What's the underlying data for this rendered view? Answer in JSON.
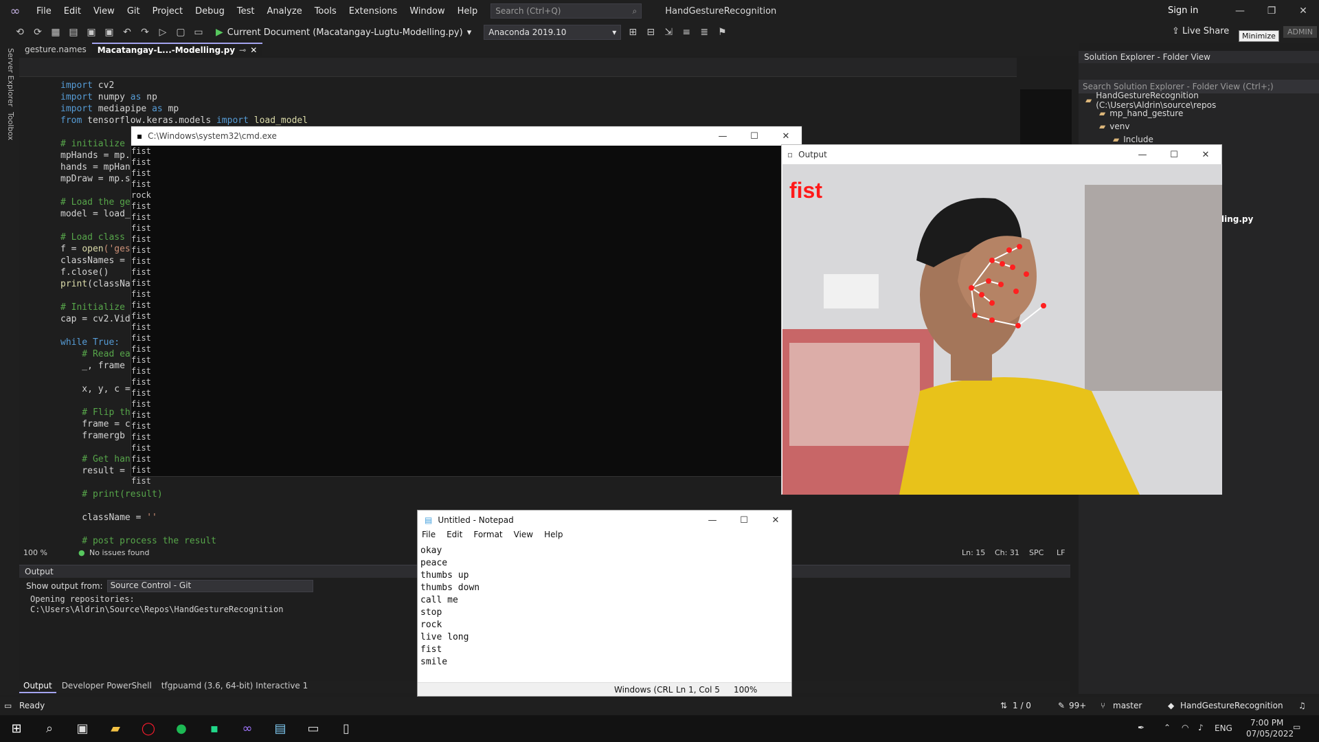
{
  "app": {
    "menus": [
      "File",
      "Edit",
      "View",
      "Git",
      "Project",
      "Debug",
      "Test",
      "Analyze",
      "Tools",
      "Extensions",
      "Window",
      "Help"
    ],
    "search_placeholder": "Search (Ctrl+Q)",
    "solution_name": "HandGestureRecognition",
    "sign_in": "Sign in",
    "live_share": "Live Share",
    "admin": "ADMIN",
    "tooltip": "Minimize"
  },
  "toolbar": {
    "run_label": "Current Document (Macatangay-Lugtu-Modelling.py)",
    "environment": "Anaconda 2019.10"
  },
  "side": {
    "server_explorer": "Server Explorer",
    "toolbox": "Toolbox"
  },
  "tabs": [
    {
      "label": "gesture.names"
    },
    {
      "label": "Macatangay-L...-Modelling.py"
    }
  ],
  "code": {
    "l1_kw": "import",
    "l1_rest": " cv2",
    "l2_kw": "import",
    "l2_rest": " numpy ",
    "l2_as": "as",
    "l2_alias": " np",
    "l3_kw": "import",
    "l3_rest": " mediapipe ",
    "l3_as": "as",
    "l3_alias": " mp",
    "l4_kw": "from",
    "l4_rest": " tensorflow.keras.models ",
    "l4_imp": "import",
    "l4_fn": " load_model",
    "l6": "# initialize m",
    "l7": "mpHands = mp.s",
    "l8": "hands = mpHand",
    "l9": "mpDraw = mp.so",
    "l11": "# Load the ges",
    "l12": "model = load_m",
    "l14": "# Load class n",
    "l15a": "f = ",
    "l15b": "open",
    "l15c": "('ges",
    "l16": "classNames = f",
    "l17": "f.close()",
    "l18a": "print",
    "l18b": "(classNam",
    "l20": "# Initialize t",
    "l21": "cap = cv2.Vide",
    "l23a": "while",
    "l23b": " True:",
    "l24": "    # Read eac",
    "l25": "    _, frame =",
    "l27": "    x, y, c =",
    "l29": "    # Flip the",
    "l30": "    frame = cv",
    "l31": "    framergb =",
    "l33": "    # Get hand",
    "l34": "    result = h",
    "l36": "    # print(result)",
    "l38a": "    className = ",
    "l38b": "''",
    "l40": "    # post process the result"
  },
  "editor_status": {
    "zoom": "100 %",
    "issues": "No issues found",
    "ln": "Ln: 15",
    "ch": "Ch: 31",
    "spc": "SPC",
    "lf": "LF"
  },
  "output_panel": {
    "title": "Output",
    "show_from_label": "Show output from:",
    "source": "Source Control - Git",
    "lines": [
      "Opening repositories:",
      "C:\\Users\\Aldrin\\Source\\Repos\\HandGestureRecognition"
    ]
  },
  "bottom_tabs": [
    "Output",
    "Developer PowerShell",
    "tfgpuamd (3.6, 64-bit) Interactive 1"
  ],
  "status_bar": {
    "ready": "Ready",
    "sync": "1 / 0",
    "changes": "99+",
    "branch": "master",
    "repo": "HandGestureRecognition"
  },
  "solution_explorer": {
    "title": "Solution Explorer - Folder View",
    "search": "Search Solution Explorer - Folder View (Ctrl+;)",
    "root": "HandGestureRecognition (C:\\Users\\Aldrin\\source\\repos",
    "items": [
      "mp_hand_gesture",
      "venv",
      "Include"
    ],
    "partial_file": "ling.py"
  },
  "cmd": {
    "title": "C:\\Windows\\system32\\cmd.exe",
    "lines": [
      "fist",
      "fist",
      "fist",
      "fist",
      "rock",
      "fist",
      "fist",
      "fist",
      "fist",
      "fist",
      "fist",
      "fist",
      "fist",
      "fist",
      "fist",
      "fist",
      "fist",
      "fist",
      "fist",
      "fist",
      "fist",
      "fist",
      "fist",
      "fist",
      "fist",
      "fist",
      "fist",
      "fist",
      "fist",
      "fist",
      "fist"
    ]
  },
  "output_window": {
    "title": "Output",
    "prediction": "fist",
    "prediction_color": "#ff1a1a",
    "landmark_color": "#ff2020"
  },
  "notepad": {
    "title": "Untitled - Notepad",
    "menus": [
      "File",
      "Edit",
      "Format",
      "View",
      "Help"
    ],
    "lines": [
      "okay",
      "peace",
      "thumbs up",
      "thumbs down",
      "call me",
      "stop",
      "rock",
      "live long",
      "fist",
      "smile"
    ],
    "encoding": "Windows (CRL",
    "position": "Ln 1, Col 5",
    "zoom": "100%"
  },
  "taskbar": {
    "time": "7:00 PM",
    "date": "07/05/2022",
    "lang": "ENG"
  }
}
